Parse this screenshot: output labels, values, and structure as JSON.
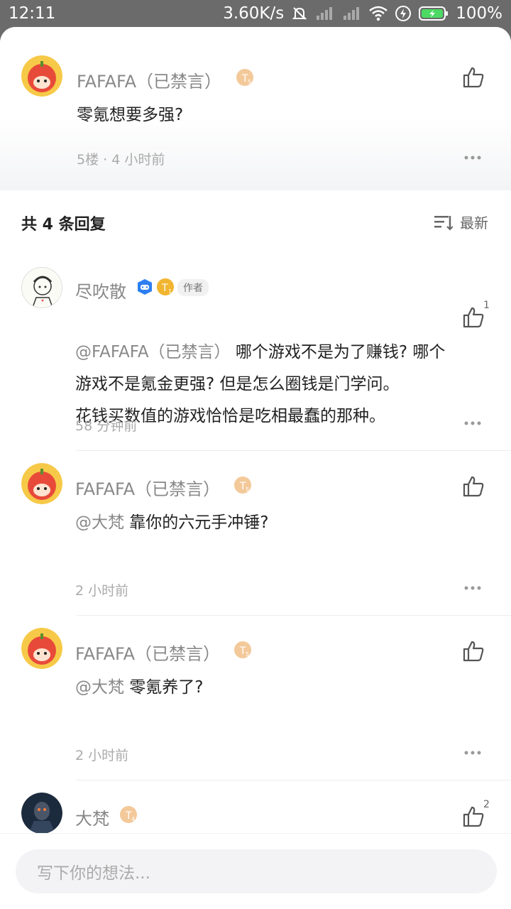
{
  "status_bar": {
    "time": "12:11",
    "speed": "3.60K/s",
    "battery": "100%"
  },
  "main_post": {
    "username": "FAFAFA（已禁言）",
    "level": "T5",
    "content": "零氪想要多强?",
    "meta": "5楼 · 4 小时前"
  },
  "replies_header": {
    "title": "共 4 条回复",
    "sort_label": "最新"
  },
  "replies": [
    {
      "username": "尽吹散",
      "author_tag": "作者",
      "like_count": "1",
      "lines": [
        "@FAFAFA（已禁言） 哪个游戏不是为了赚钱? 哪个",
        "游戏不是氪金更强? 但是怎么圈钱是门学问。",
        "花钱买数值的游戏恰恰是吃相最蠢的那种。"
      ],
      "time": "58 分钟前"
    },
    {
      "username": "FAFAFA（已禁言）",
      "mention": "@大梵",
      "text": " 靠你的六元手冲锤?",
      "time": "2 小时前"
    },
    {
      "username": "FAFAFA（已禁言）",
      "mention": "@大梵",
      "text": " 零氪养了?",
      "time": "2 小时前"
    },
    {
      "username": "大梵",
      "like_count": "2"
    }
  ],
  "input": {
    "placeholder": "写下你的想法..."
  }
}
